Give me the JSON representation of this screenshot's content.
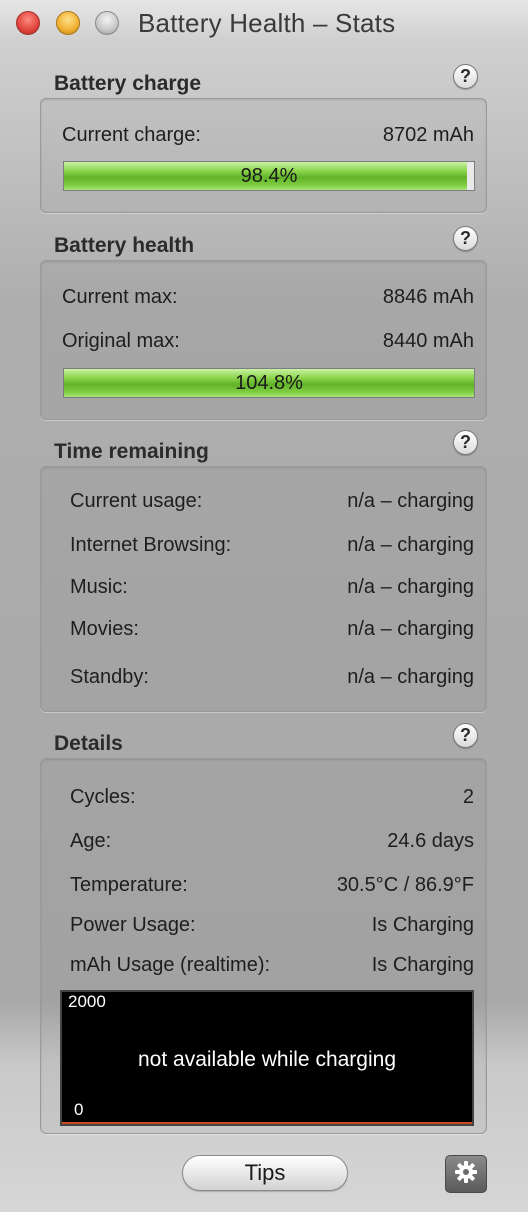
{
  "window": {
    "title": "Battery Health – Stats"
  },
  "sections": {
    "charge": {
      "title": "Battery charge",
      "current_label": "Current charge:",
      "current_value": "8702 mAh",
      "percent_text": "98.4%",
      "percent": 98.4
    },
    "health": {
      "title": "Battery health",
      "current_max_label": "Current max:",
      "current_max_value": "8846 mAh",
      "original_max_label": "Original max:",
      "original_max_value": "8440 mAh",
      "percent_text": "104.8%",
      "percent": 104.8
    },
    "time": {
      "title": "Time remaining",
      "rows": [
        {
          "label": "Current usage:",
          "value": "n/a – charging"
        },
        {
          "label": "Internet Browsing:",
          "value": "n/a – charging"
        },
        {
          "label": "Music:",
          "value": "n/a – charging"
        },
        {
          "label": "Movies:",
          "value": "n/a – charging"
        },
        {
          "label": "Standby:",
          "value": "n/a – charging"
        }
      ]
    },
    "details": {
      "title": "Details",
      "rows": [
        {
          "label": "Cycles:",
          "value": "2"
        },
        {
          "label": "Age:",
          "value": "24.6 days"
        },
        {
          "label": "Temperature:",
          "value": "30.5°C / 86.9°F"
        },
        {
          "label": "Power Usage:",
          "value": "Is Charging"
        },
        {
          "label": "mAh Usage (realtime):",
          "value": "Is Charging"
        }
      ],
      "graph": {
        "y_max": "2000",
        "y_min": "0",
        "message": "not available while charging"
      }
    }
  },
  "help_label": "?",
  "footer": {
    "tips_label": "Tips",
    "settings_icon": "gear-icon"
  },
  "colors": {
    "bar_green": "#7ccb3f",
    "graph_line": "#c94a1c"
  }
}
